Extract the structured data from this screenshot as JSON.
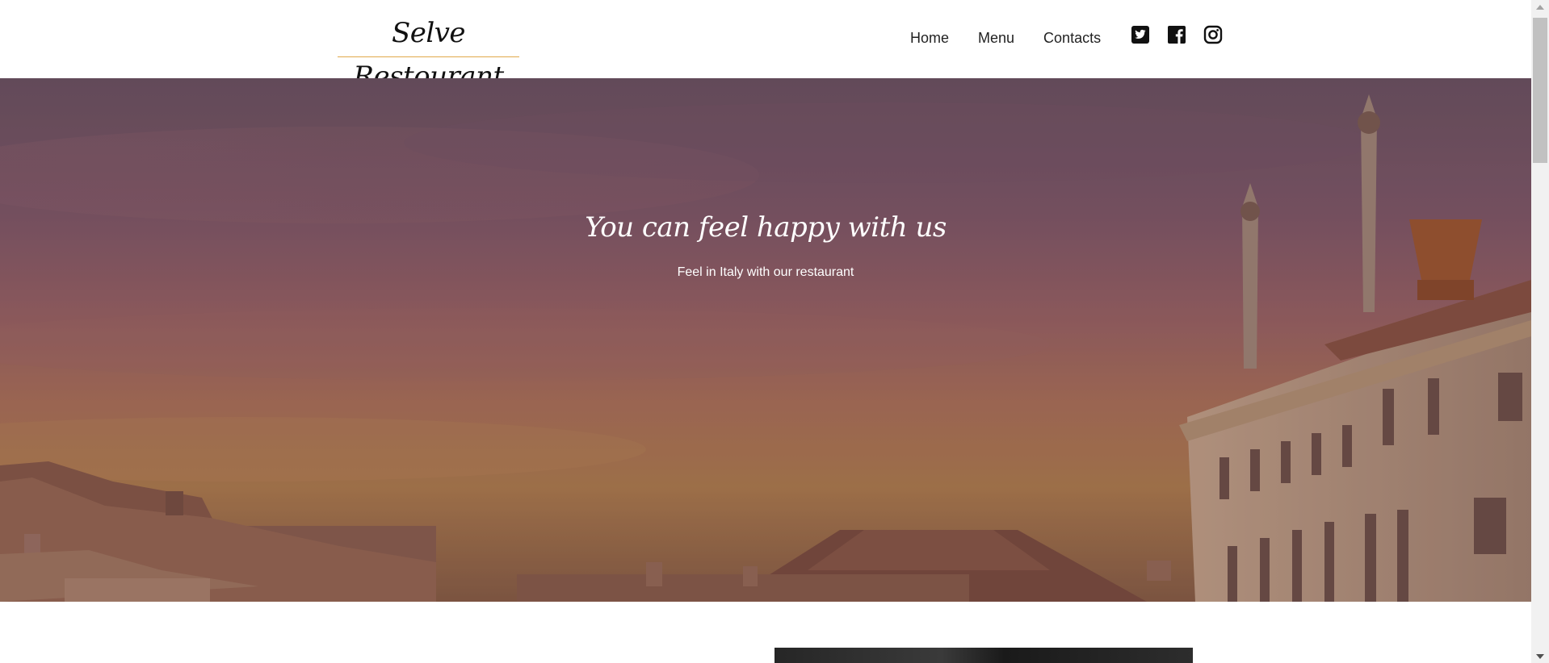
{
  "header": {
    "logo_text": "Selve Restourant",
    "nav": [
      {
        "label": "Home"
      },
      {
        "label": "Menu"
      },
      {
        "label": "Contacts"
      }
    ],
    "social": [
      {
        "icon": "twitter-icon"
      },
      {
        "icon": "facebook-icon"
      },
      {
        "icon": "instagram-icon"
      }
    ]
  },
  "hero": {
    "title": "You can feel happy with us",
    "subtitle": "Feel in Italy with our restaurant"
  },
  "colors": {
    "accent_underline": "#e0a94a",
    "hero_overlay": "#8a5e62",
    "text_dark": "#222222"
  }
}
